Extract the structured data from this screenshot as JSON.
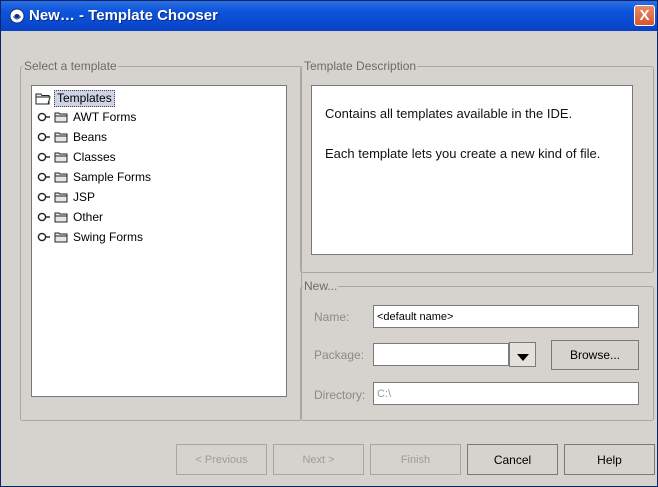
{
  "window": {
    "title": "New… - Template Chooser",
    "close_label": "X"
  },
  "select_group": {
    "legend": "Select a template",
    "root_label": "Templates",
    "items": [
      {
        "label": "AWT Forms"
      },
      {
        "label": "Beans"
      },
      {
        "label": "Classes"
      },
      {
        "label": "Sample Forms"
      },
      {
        "label": "JSP"
      },
      {
        "label": "Other"
      },
      {
        "label": "Swing Forms"
      }
    ]
  },
  "description_group": {
    "legend": "Template Description",
    "line1": "Contains all templates available in the IDE.",
    "line2": "Each template lets you create a new kind of file."
  },
  "new_group": {
    "legend": "New...",
    "name_label": "Name:",
    "name_value": "<default name>",
    "package_label": "Package:",
    "package_value": "",
    "browse_label": "Browse...",
    "directory_label": "Directory:",
    "directory_value": "C:\\"
  },
  "footer": {
    "previous_label": "< Previous",
    "next_label": "Next >",
    "finish_label": "Finish",
    "cancel_label": "Cancel",
    "help_label": "Help"
  }
}
